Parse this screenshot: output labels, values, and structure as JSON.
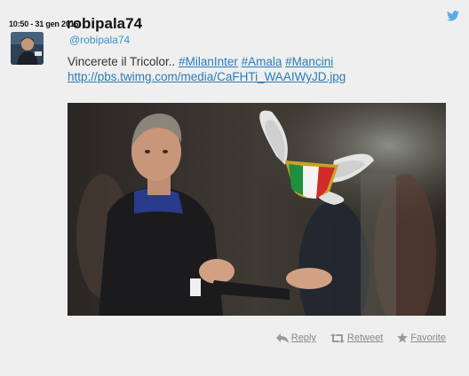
{
  "tweet": {
    "timestamp": "10:50 - 31 gen 2016",
    "display_name": "robipala74",
    "handle": "@robipala74",
    "text_prefix": "Vincerete il Tricolor.. ",
    "hashtags": [
      "#MilanInter",
      "#Amala",
      "#Mancini"
    ],
    "link": "http://pbs.twimg.com/media/CaFHTi_WAAIWyJD.jpg"
  },
  "actions": {
    "reply": "Reply",
    "retweet": "Retweet",
    "favorite": "Favorite"
  },
  "colors": {
    "link": "#2b7bb9",
    "twitter_bird": "#55acee",
    "action_gray": "#888888"
  },
  "icons": [
    "twitter-bird-icon",
    "reply-icon",
    "retweet-icon",
    "favorite-star-icon"
  ]
}
